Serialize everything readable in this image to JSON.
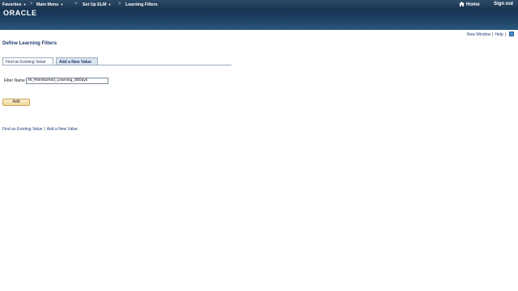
{
  "topnav": {
    "favorites": "Favorites",
    "main_menu": "Main Menu",
    "setup_elm": "Set Up ELM",
    "learning_filters": "Learning Filters",
    "home": "Home",
    "sign_out": "Sign out",
    "separator": ">"
  },
  "banner": {
    "logo": "ORACLE"
  },
  "pagelinks": {
    "new_window": "New Window",
    "help": "Help"
  },
  "page": {
    "title": "Define Learning Filters"
  },
  "tabs": [
    {
      "label": "Find an Existing Value",
      "active": true
    },
    {
      "label": "Add a New Value",
      "active": false
    }
  ],
  "form": {
    "filter_name_label": "Filter Name",
    "filter_name_value": "All_Reimbursed_Learning_30Days",
    "add_button": "Add"
  },
  "bottomlinks": {
    "find": "Find an Existing Value",
    "add": "Add a New Value"
  },
  "colors": {
    "nav": "#1c3550",
    "banner": "#1f4266",
    "link": "#1f3d7a",
    "button": "#f1d69a"
  }
}
